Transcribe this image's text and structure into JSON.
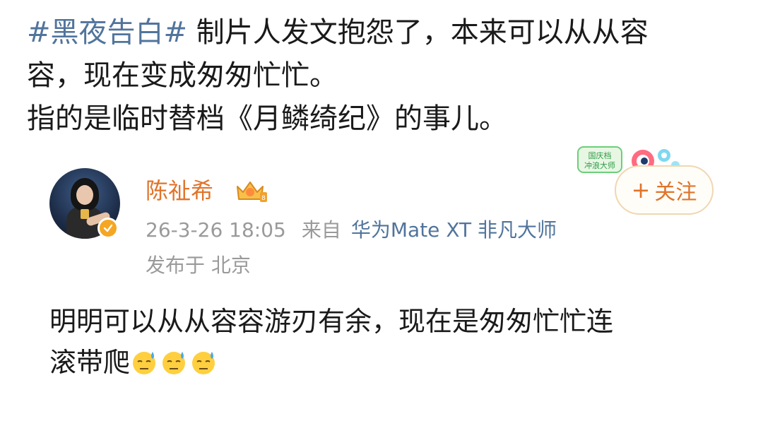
{
  "top_post": {
    "hashtag": "#黑夜告白#",
    "line1_rest": " 制片人发文抱怨了，本来可以从从容",
    "line2": "容，现在变成匆匆忙忙。",
    "line3": "指的是临时替档《月鳞绮纪》的事儿。"
  },
  "quoted_card": {
    "username": "陈祉希",
    "timestamp": "26-3-26 18:05",
    "source_prefix": "来自",
    "device": "华为Mate XT 非凡大师",
    "location": "发布于 北京",
    "event_badge_text": "国庆档冲浪大师",
    "follow_button": {
      "plus": "+",
      "label": "关注"
    },
    "body_line1": "明明可以从从容容游刃有余，现在是匆匆忙忙连",
    "body_line2": "滚带爬",
    "body_emojis": [
      "sweat-face-emoji",
      "sweat-face-emoji",
      "sweat-face-emoji"
    ]
  },
  "colors": {
    "hashtag": "#51749c",
    "username": "#e0742a",
    "meta_gray": "#9a9a9a",
    "device_link": "#51749c",
    "verified_badge": "#f5a623"
  }
}
